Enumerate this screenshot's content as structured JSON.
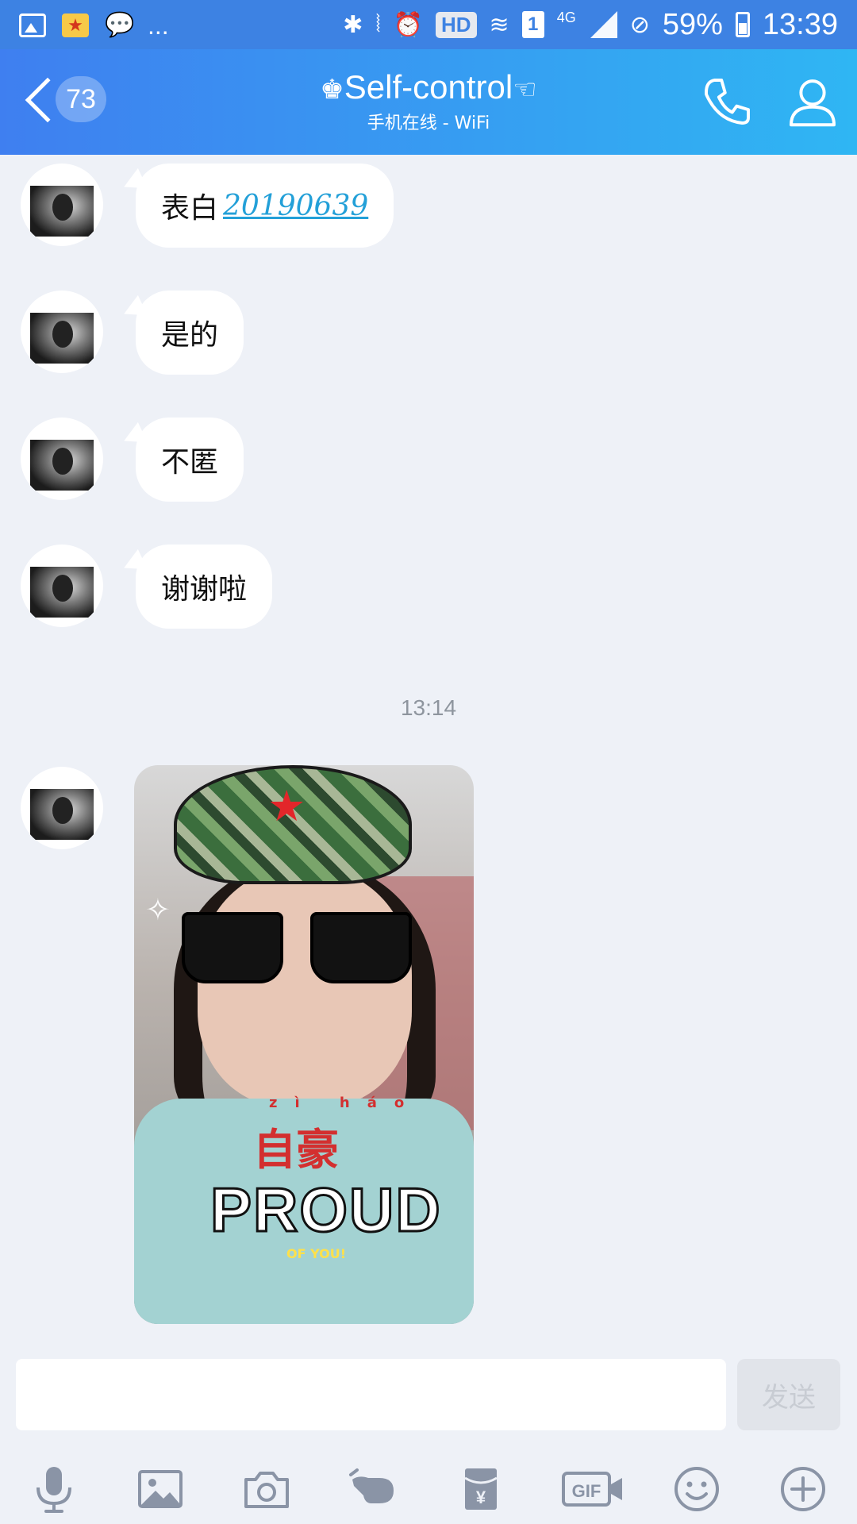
{
  "status_bar": {
    "more_indicator": "...",
    "hd_label": "HD",
    "sim_label": "1",
    "network_label": "4G",
    "battery_percent": "59%",
    "time": "13:39"
  },
  "header": {
    "unread_count": "73",
    "title": "Self-control",
    "title_prefix_icon": "crown-icon",
    "title_suffix_icon": "pointing-hand-icon",
    "subtitle": "手机在线 - WiFi"
  },
  "messages": [
    {
      "text": "表白",
      "link": "20190639"
    },
    {
      "text": "是的"
    },
    {
      "text": "不匿"
    },
    {
      "text": "谢谢啦"
    }
  ],
  "timestamp": "13:14",
  "image_message": {
    "sticker_pinyin": "zì háo",
    "sticker_cn": "自豪",
    "sticker_en": "PROUD",
    "sticker_sub": "OF YOU!"
  },
  "input": {
    "value": "",
    "send_label": "发送"
  },
  "toolbar_icons": [
    "microphone-icon",
    "image-icon",
    "camera-icon",
    "poke-hand-icon",
    "red-packet-icon",
    "gif-icon",
    "emoji-icon",
    "plus-icon"
  ],
  "colors": {
    "header_start": "#3f7ff0",
    "header_end": "#2fb6f3",
    "background": "#eef1f7",
    "link": "#23a0d8"
  }
}
